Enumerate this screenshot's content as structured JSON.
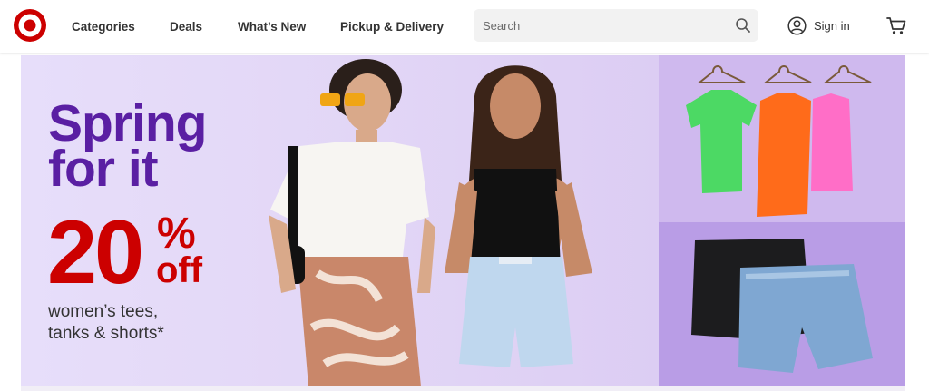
{
  "brand": {
    "logo_icon": "bullseye-logo-icon",
    "color": "#cc0000"
  },
  "nav": {
    "items": [
      {
        "label": "Categories"
      },
      {
        "label": "Deals"
      },
      {
        "label": "What’s New"
      },
      {
        "label": "Pickup & Delivery"
      }
    ]
  },
  "search": {
    "placeholder": "Search",
    "value": "",
    "icon": "search-icon"
  },
  "account": {
    "signin_label": "Sign in",
    "icon": "user-circle-icon"
  },
  "cart": {
    "icon": "cart-icon"
  },
  "hero": {
    "headline_line1": "Spring",
    "headline_line2": "for it",
    "deal_number": "20",
    "deal_percent": "%",
    "deal_off": "off",
    "subtext_line1": "women’s tees,",
    "subtext_line2": "tanks & shorts*",
    "colors": {
      "headline": "#5a1fa3",
      "deal": "#cc0000",
      "panel_bg": "#e4d9f8",
      "tile_top_bg": "#cfb9ee",
      "tile_bottom_bg": "#b99de6"
    }
  }
}
